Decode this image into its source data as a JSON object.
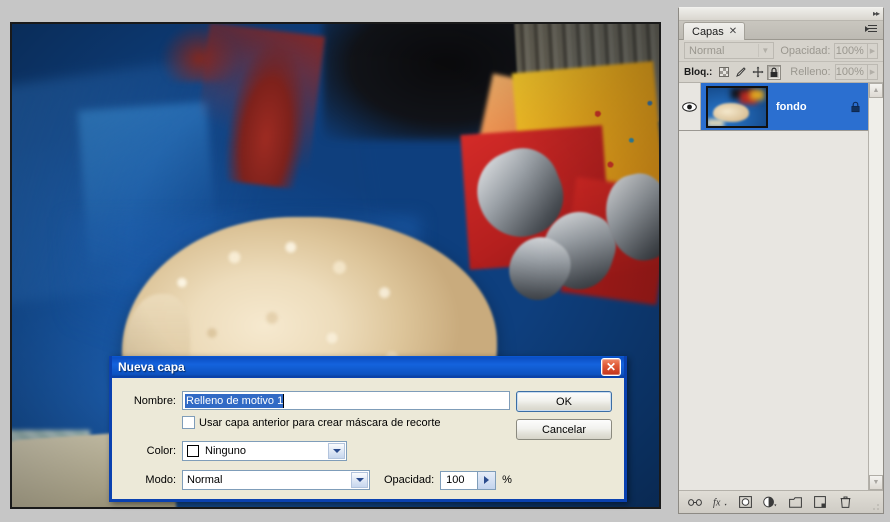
{
  "app": {
    "canvas_alt": "Sleeping cream curly-haired dog on blue Spiderman bedding"
  },
  "layers_panel": {
    "tab_label": "Capas",
    "tab_close_icon": "close-icon",
    "collapse_icon": "▸▸",
    "blend_mode": "Normal",
    "opacity_label": "Opacidad:",
    "opacity_value": "100%",
    "lock_label": "Bloq.:",
    "lock_icons": [
      "checkerboard-lock-icon",
      "brush-lock-icon",
      "move-lock-icon",
      "lock-all-icon"
    ],
    "fill_label": "Relleno:",
    "fill_value": "100%",
    "layers": [
      {
        "name": "fondo",
        "visible": true,
        "locked": true,
        "selected": true
      }
    ],
    "bottom_buttons": [
      {
        "name": "link-layers-icon",
        "glyph": "⚭"
      },
      {
        "name": "layer-styles-fx-icon",
        "glyph": "ƒx"
      },
      {
        "name": "add-layer-mask-icon",
        "glyph": "□"
      },
      {
        "name": "new-adjustment-layer-icon",
        "glyph": "◐"
      },
      {
        "name": "new-group-icon",
        "glyph": "▭"
      },
      {
        "name": "new-layer-icon",
        "glyph": "❐"
      },
      {
        "name": "delete-layer-icon",
        "glyph": "🗑"
      }
    ]
  },
  "dialog": {
    "title": "Nueva capa",
    "close_icon": "✕",
    "name_label": "Nombre:",
    "name_value": "Relleno de motivo 1",
    "clipping_checkbox_label": "Usar capa anterior para crear máscara de recorte",
    "clipping_checked": false,
    "color_label": "Color:",
    "color_value": "Ninguno",
    "mode_label": "Modo:",
    "mode_value": "Normal",
    "opacity_label": "Opacidad:",
    "opacity_value": "100",
    "percent_symbol": "%",
    "ok_label": "OK",
    "cancel_label": "Cancelar"
  },
  "colors": {
    "title_blue": "#0a59d6",
    "selection_blue": "#316ac5",
    "layer_selected_blue": "#2b6fd0",
    "panel_gray": "#d6d3cc",
    "dialog_face": "#ece9d8"
  }
}
